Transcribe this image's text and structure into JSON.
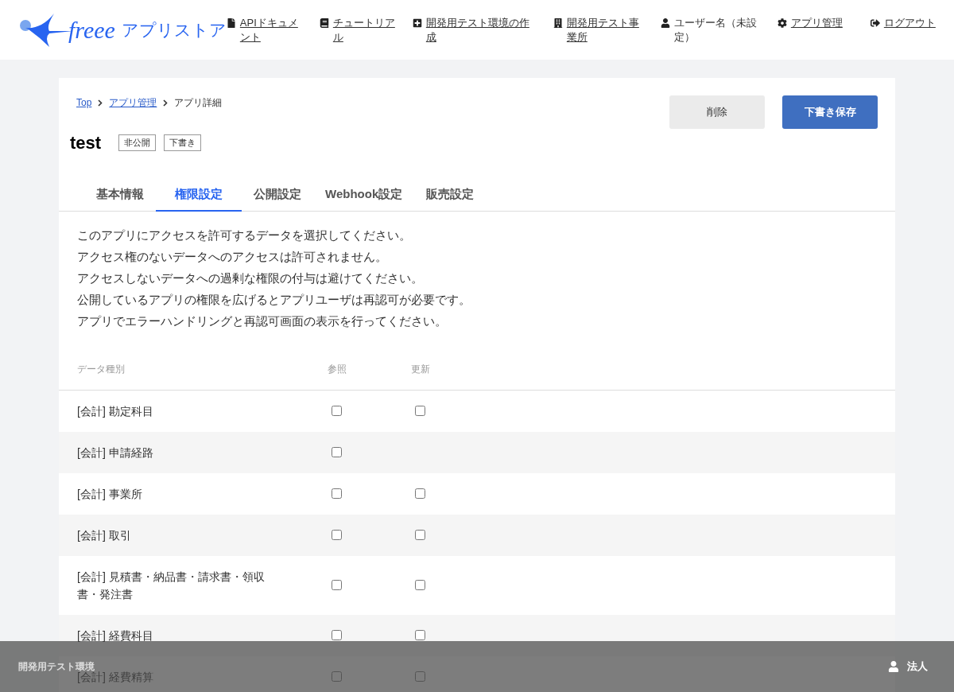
{
  "header": {
    "logo_text": "freee",
    "store_label": "アプリストア",
    "nav": [
      {
        "kind": "link",
        "label": "APIドキュメント"
      },
      {
        "kind": "link",
        "label": "チュートリアル"
      },
      {
        "kind": "link",
        "label": "開発用テスト環境の作成"
      },
      {
        "kind": "link",
        "label": "開発用テスト事業所"
      },
      {
        "kind": "text",
        "label": "ユーザー名（未設定）"
      },
      {
        "kind": "link",
        "label": "アプリ管理"
      },
      {
        "kind": "link",
        "label": "ログアウト"
      }
    ]
  },
  "breadcrumb": [
    {
      "label": "Top",
      "link": true
    },
    {
      "label": "アプリ管理",
      "link": true
    },
    {
      "label": "アプリ詳細",
      "link": false
    }
  ],
  "app": {
    "name": "test",
    "badges": [
      "非公開",
      "下書き"
    ]
  },
  "buttons": [
    {
      "label": "削除",
      "kind": "secondary"
    },
    {
      "label": "下書き保存",
      "kind": "primary"
    }
  ],
  "tabs": [
    {
      "label": "基本情報",
      "selected": false
    },
    {
      "label": "権限設定",
      "selected": true
    },
    {
      "label": "公開設定",
      "selected": false
    },
    {
      "label": "Webhook設定",
      "selected": false
    },
    {
      "label": "販売設定",
      "selected": false
    }
  ],
  "description": [
    "このアプリにアクセスを許可するデータを選択してください。",
    "アクセス権のないデータへのアクセスは許可されません。",
    "アクセスしないデータへの過剰な権限の付与は避けてください。",
    "公開しているアプリの権限を広げるとアプリユーザは再認可が必要です。",
    "アプリでエラーハンドリングと再認可画面の表示を行ってください。"
  ],
  "table": {
    "columns": [
      "データ種別",
      "参照",
      "更新"
    ],
    "rows": [
      {
        "name": "[会計] 勘定科目",
        "read": {
          "checked": false
        },
        "write": {
          "checked": false
        }
      },
      {
        "name": "[会計] 申請経路",
        "read": {
          "checked": false
        }
      },
      {
        "name": "[会計] 事業所",
        "read": {
          "checked": false
        },
        "write": {
          "checked": false
        }
      },
      {
        "name": "[会計] 取引",
        "read": {
          "checked": false
        },
        "write": {
          "checked": false
        }
      },
      {
        "name": "[会計] 見積書・納品書・請求書・領収書・発注書",
        "read": {
          "checked": false
        },
        "write": {
          "checked": false
        }
      },
      {
        "name": "[会計] 経費科目",
        "read": {
          "checked": false
        },
        "write": {
          "checked": false
        }
      },
      {
        "name": "[会計] 経費精算",
        "read": {
          "checked": false
        },
        "write": {
          "checked": false
        }
      }
    ]
  },
  "env_bar": {
    "label": "開発用テスト環境",
    "account": "法人"
  }
}
